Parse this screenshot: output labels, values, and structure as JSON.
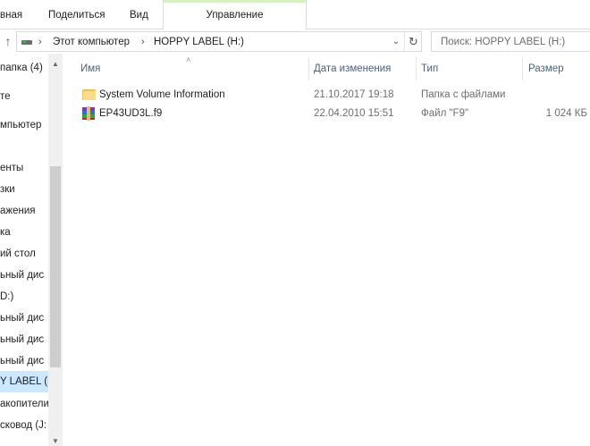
{
  "ribbon": {
    "tabs": [
      {
        "label": "вная"
      },
      {
        "label": "Поделиться"
      },
      {
        "label": "Вид"
      }
    ],
    "contextual_tab": {
      "label": "Управление",
      "accent": "#d9f2c4"
    }
  },
  "address": {
    "crumbs": [
      "Этот компьютер",
      "HOPPY LABEL (H:)"
    ]
  },
  "search": {
    "placeholder": "Поиск: HOPPY LABEL (H:)"
  },
  "navpane": {
    "items": [
      {
        "label": " папка (4)"
      },
      {
        "label": "те"
      },
      {
        "label": "мпьютер"
      },
      {
        "label": "енты"
      },
      {
        "label": "зки"
      },
      {
        "label": "ажения"
      },
      {
        "label": "ка"
      },
      {
        "label": "ий стол"
      },
      {
        "label": "ьный дис"
      },
      {
        "label": "D:)"
      },
      {
        "label": "ьный дис"
      },
      {
        "label": "ьный дис"
      },
      {
        "label": "ьный дис"
      },
      {
        "label": "Y LABEL (H"
      },
      {
        "label": "акопители"
      },
      {
        "label": "сковод (J:"
      }
    ],
    "selected_index": 13,
    "selected_color": "#cce8ff"
  },
  "filelist": {
    "columns": [
      "Имя",
      "Дата изменения",
      "Тип",
      "Размер"
    ],
    "rows": [
      {
        "name": "System Volume Information",
        "date": "21.10.2017 19:18",
        "type": "Папка с файлами",
        "size": "",
        "icon": "folder-icon"
      },
      {
        "name": "EP43UD3L.f9",
        "date": "22.04.2010 15:51",
        "type": "Файл \"F9\"",
        "size": "1 024 КБ",
        "icon": "archive-file-icon"
      }
    ]
  }
}
